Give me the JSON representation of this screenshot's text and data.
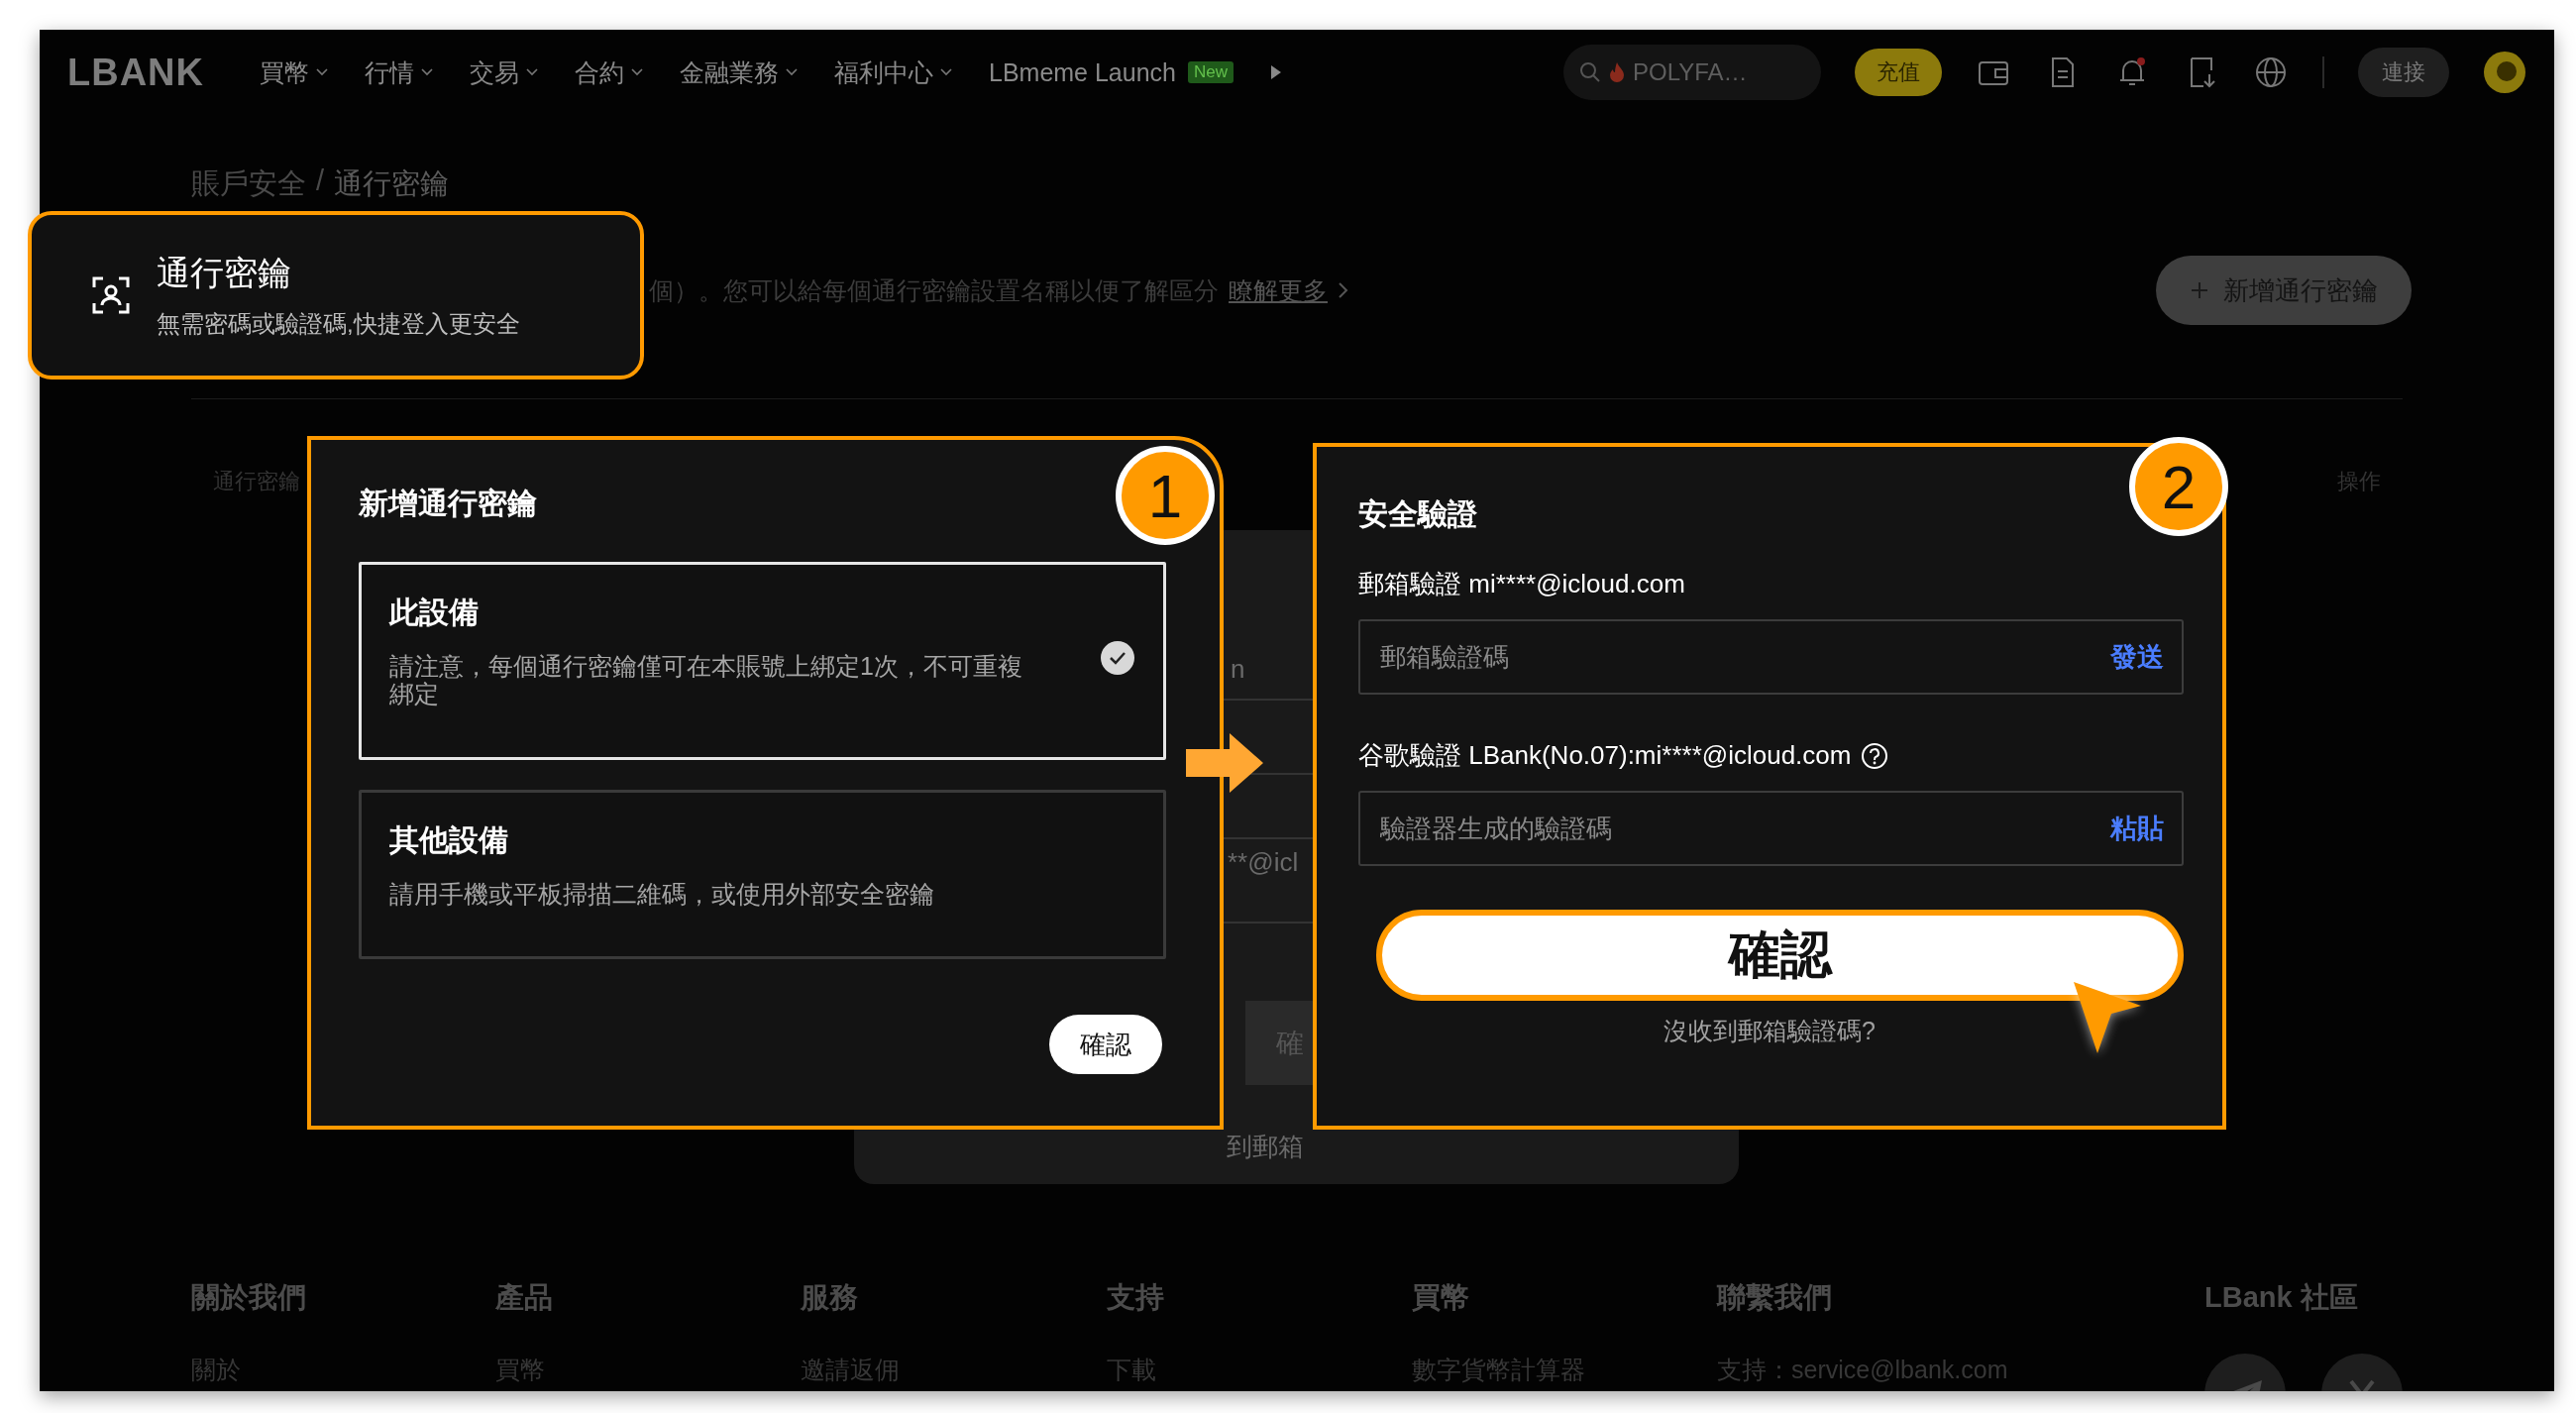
{
  "nav": {
    "logo": "LBANK",
    "items": [
      {
        "label": "買幣",
        "dropdown": true
      },
      {
        "label": "行情",
        "dropdown": true
      },
      {
        "label": "交易",
        "dropdown": true
      },
      {
        "label": "合約",
        "dropdown": true
      },
      {
        "label": "金融業務",
        "dropdown": true
      },
      {
        "label": "福利中心",
        "dropdown": true
      },
      {
        "label": "LBmeme Launch",
        "dropdown": false,
        "badge": "New"
      }
    ],
    "search": {
      "placeholder": "POLYFA…"
    },
    "deposit_button": "充值",
    "connect_button": "連接"
  },
  "breadcrumb": {
    "items": [
      "賬戶安全",
      "通行密鑰"
    ],
    "separator": "/"
  },
  "description": {
    "text": "個）。您可以給每個通行密鑰設置名稱以便了解區分",
    "link": "瞭解更多"
  },
  "add_button": "新增通行密鑰",
  "table": {
    "columns": [
      "通行密鑰",
      "操作"
    ]
  },
  "background_dialog": {
    "texts": [
      "n",
      "**@icl",
      "確",
      "到郵箱"
    ]
  },
  "callout": {
    "title": "通行密鑰",
    "subtitle": "無需密碼或驗證碼,快捷登入更安全"
  },
  "device_modal": {
    "step": "1",
    "title": "新增通行密鑰",
    "options": [
      {
        "title": "此設備",
        "description": "請注意，每個通行密鑰僅可在本賬號上綁定1次，不可重複綁定",
        "selected": true
      },
      {
        "title": "其他設備",
        "description": "請用手機或平板掃描二維碼，或使用外部安全密鑰",
        "selected": false
      }
    ],
    "confirm": "確認"
  },
  "verify_modal": {
    "step": "2",
    "title": "安全驗證",
    "fields": [
      {
        "label": "郵箱驗證 mi****@icloud.com",
        "placeholder": "郵箱驗證碼",
        "action": "發送",
        "help": false
      },
      {
        "label": "谷歌驗證 LBank(No.07):mi****@icloud.com",
        "placeholder": "驗證器生成的驗證碼",
        "action": "粘貼",
        "help": true
      }
    ],
    "confirm": "確認",
    "resend_link": "沒收到郵箱驗證碼?"
  },
  "footer": {
    "columns": [
      {
        "heading": "關於我們",
        "links": [
          "關於"
        ]
      },
      {
        "heading": "產品",
        "links": [
          "買幣"
        ]
      },
      {
        "heading": "服務",
        "links": [
          "邀請返佣"
        ]
      },
      {
        "heading": "支持",
        "links": [
          "下載"
        ]
      },
      {
        "heading": "買幣",
        "links": [
          "數字貨幣計算器"
        ]
      },
      {
        "heading": "聯繫我們",
        "links": [
          "支持：service@lbank.com"
        ]
      }
    ],
    "community": {
      "heading": "LBank 社區"
    }
  }
}
